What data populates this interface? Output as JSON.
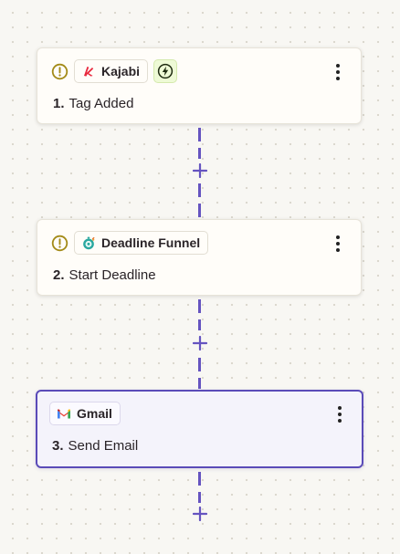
{
  "steps": [
    {
      "number": "1.",
      "title": "Tag Added",
      "app": "Kajabi",
      "app_icon": "kajabi-logo-icon",
      "has_warning": true,
      "is_trigger": true,
      "selected": false
    },
    {
      "number": "2.",
      "title": "Start Deadline",
      "app": "Deadline Funnel",
      "app_icon": "deadline-funnel-logo-icon",
      "has_warning": true,
      "is_trigger": false,
      "selected": false
    },
    {
      "number": "3.",
      "title": "Send Email",
      "app": "Gmail",
      "app_icon": "gmail-logo-icon",
      "has_warning": false,
      "is_trigger": false,
      "selected": true
    }
  ],
  "icons": {
    "warning": "warning-circle-icon",
    "trigger": "lightning-bolt-icon",
    "menu": "more-vertical-icon",
    "add": "plus-icon"
  },
  "colors": {
    "accent": "#5a4bb8",
    "connector": "#6554c0",
    "warning": "#a38a17",
    "trigger_bg": "#eefad6",
    "canvas_bg": "#f8f7f3"
  }
}
